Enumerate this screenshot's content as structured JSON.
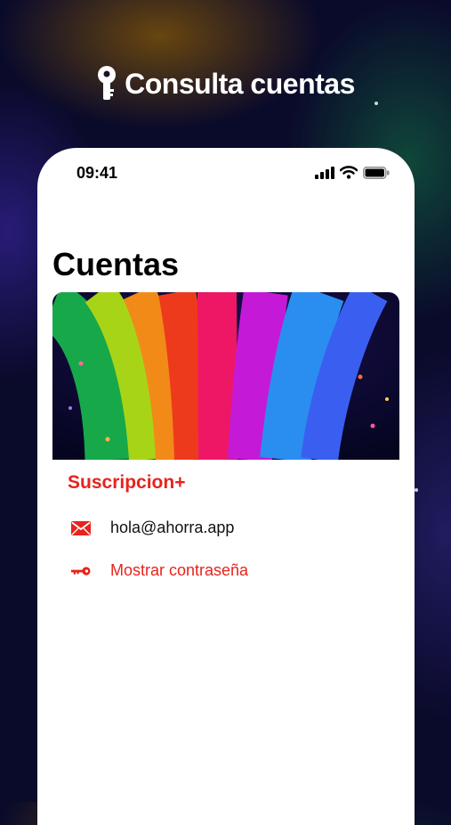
{
  "header": {
    "title": "Consulta cuentas",
    "icon": "key-icon"
  },
  "status_bar": {
    "time": "09:41",
    "icons": [
      "signal-icon",
      "wifi-icon",
      "battery-icon"
    ]
  },
  "page": {
    "title": "Cuentas"
  },
  "account": {
    "banner_image": "rainbow-arches-image",
    "name": "Suscripcion+",
    "email": "hola@ahorra.app",
    "show_password_label": "Mostrar contraseña",
    "email_icon": "envelope-icon",
    "password_icon": "key-icon"
  },
  "colors": {
    "accent": "#e8231c",
    "background": "#0a0a2a",
    "card": "#ffffff"
  }
}
